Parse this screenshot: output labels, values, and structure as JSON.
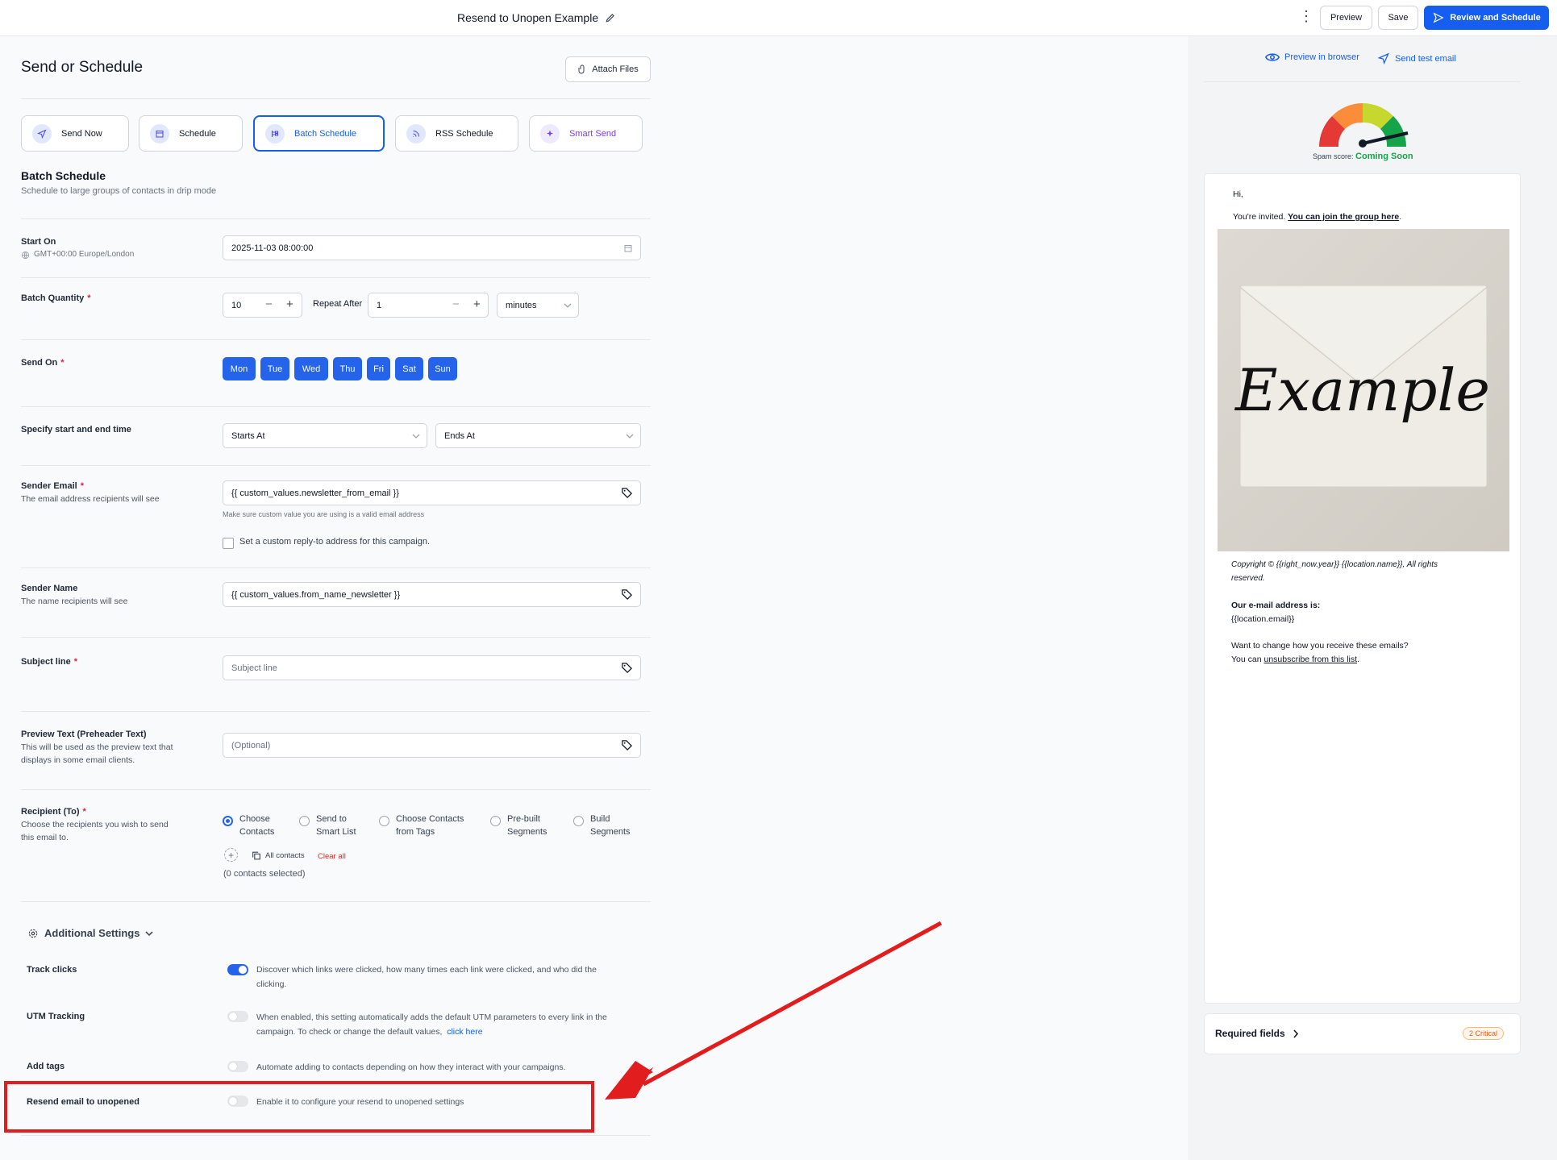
{
  "header": {
    "title": "Resend to Unopen Example",
    "preview_label": "Preview",
    "save_label": "Save",
    "review_label": "Review and Schedule"
  },
  "main": {
    "title": "Send or Schedule",
    "attach_label": "Attach Files"
  },
  "send_types": [
    {
      "label": "Send Now"
    },
    {
      "label": "Schedule"
    },
    {
      "label": "Batch Schedule"
    },
    {
      "label": "RSS Schedule"
    },
    {
      "label": "Smart Send"
    }
  ],
  "batch": {
    "title": "Batch Schedule",
    "subtitle": "Schedule to large groups of contacts in drip mode",
    "start_on_label": "Start On",
    "timezone": "GMT+00:00 Europe/London",
    "start_on_value": "2025-11-03 08:00:00",
    "batch_qty_label": "Batch Quantity",
    "batch_qty_value": "10",
    "repeat_after_label": "Repeat After",
    "repeat_after_value": "1",
    "unit_value": "minutes",
    "send_on_label": "Send On",
    "days": [
      "Mon",
      "Tue",
      "Wed",
      "Thu",
      "Fri",
      "Sat",
      "Sun"
    ],
    "start_end_label": "Specify start and end time",
    "starts_at": "Starts At",
    "ends_at": "Ends At"
  },
  "sender": {
    "email_label": "Sender Email",
    "email_sub": "The email address recipients will see",
    "email_value": "{{ custom_values.newsletter_from_email }}",
    "email_hint": "Make sure custom value you are using is a valid email address",
    "reply_to_label": "Set a custom reply-to address for this campaign.",
    "name_label": "Sender Name",
    "name_sub": "The name recipients will see",
    "name_value": "{{ custom_values.from_name_newsletter }}"
  },
  "subject": {
    "label": "Subject line",
    "placeholder": "Subject line"
  },
  "preheader": {
    "label": "Preview Text (Preheader Text)",
    "sub1": "This will be used as the preview text that",
    "sub2": "displays in some email clients.",
    "placeholder": "(Optional)"
  },
  "recipient": {
    "label": "Recipient (To)",
    "sub1": "Choose the recipients you wish to send",
    "sub2": "this email to.",
    "options": [
      {
        "l1": "Choose",
        "l2": "Contacts"
      },
      {
        "l1": "Send to",
        "l2": "Smart List"
      },
      {
        "l1": "Choose Contacts",
        "l2": "from Tags"
      },
      {
        "l1": "Pre-built",
        "l2": "Segments"
      },
      {
        "l1": "Build",
        "l2": "Segments"
      }
    ],
    "all_contacts": "All contacts",
    "clear_all": "Clear all",
    "selected": "(0 contacts selected)"
  },
  "additional": {
    "title": "Additional Settings",
    "track_label": "Track clicks",
    "track_d1": "Discover which links were clicked, how many times each link were clicked, and who did the",
    "track_d2": "clicking.",
    "utm_label": "UTM Tracking",
    "utm_d1": "When enabled, this setting automatically adds the default UTM parameters to every link in the",
    "utm_d2": "campaign. To check or change the default values,",
    "utm_link": "click here",
    "tags_label": "Add tags",
    "tags_d": "Automate adding to contacts depending on how they interact with your campaigns.",
    "resend_label": "Resend email to unopened",
    "resend_d": "Enable it to configure your resend to unopened settings"
  },
  "preview": {
    "browser_label": "Preview in browser",
    "test_label": "Send test email",
    "spam_label": "Spam score:",
    "spam_value": "Coming Soon",
    "hi": "Hi,",
    "invited": "You're invited.",
    "join": "You can join the group here",
    "envelope_text": "Example",
    "copyright1": "Copyright © {{right_now.year}}  {{location.name}}, All rights",
    "copyright2": "reserved.",
    "address_label": "Our e-mail address is:",
    "address_value": "{{location.email}}",
    "change1": "Want to change how you receive these emails?",
    "change2": "You can",
    "unsub": "unsubscribe from this list",
    "required_label": "Required fields",
    "critical_badge": "2 Critical"
  },
  "colors": {
    "accent": "#155eef",
    "highlight": "#e11d1d"
  }
}
